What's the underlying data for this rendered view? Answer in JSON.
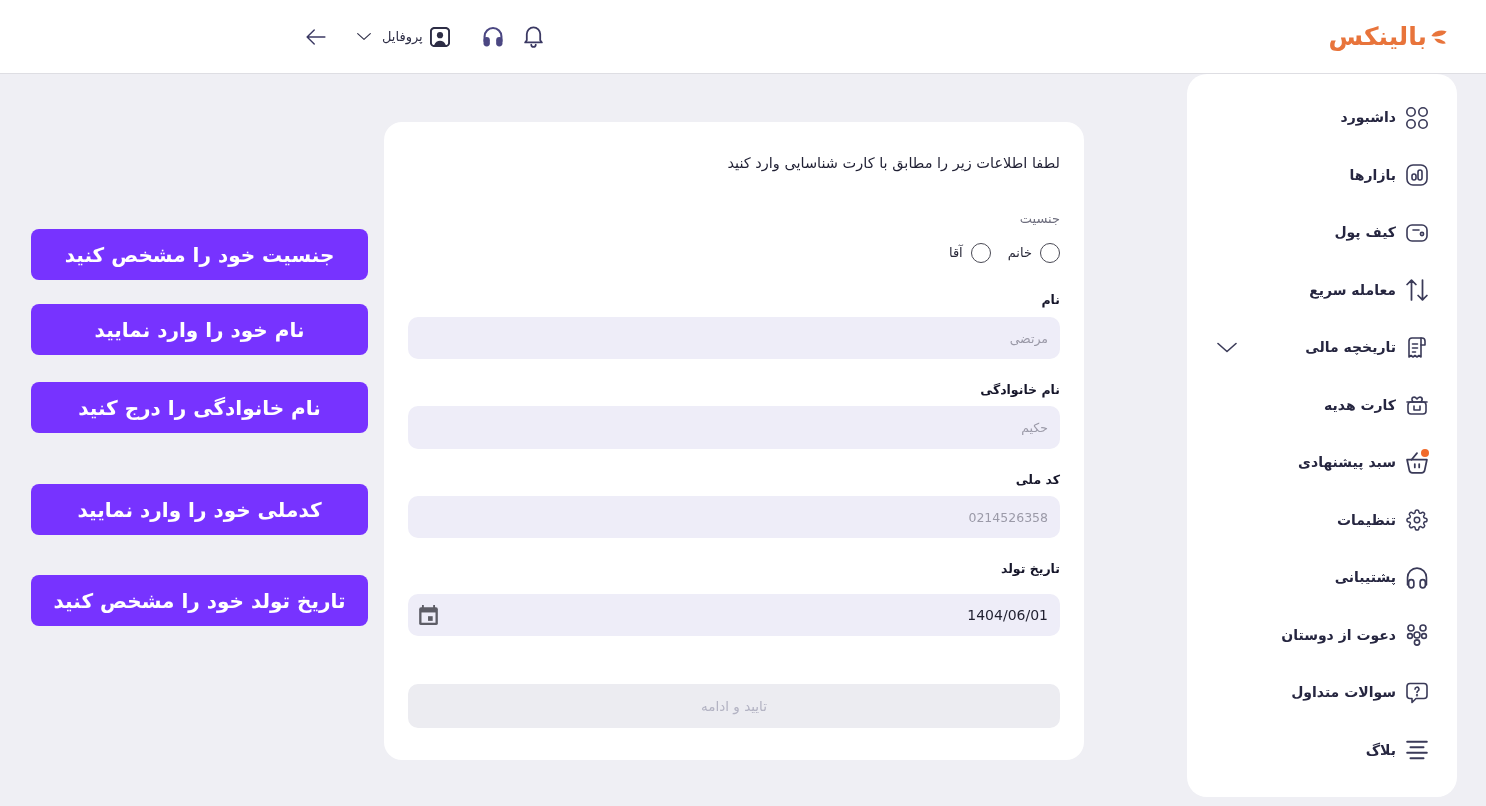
{
  "header": {
    "logo": "بالینکس",
    "profile": {
      "label": "پروفایل",
      "expanded": false
    }
  },
  "sidebar": {
    "items": [
      {
        "label": "داشبورد",
        "kind": "link",
        "notify": false
      },
      {
        "label": "بازارها",
        "kind": "link",
        "notify": false
      },
      {
        "label": "کیف پول",
        "kind": "link",
        "notify": false
      },
      {
        "label": "معامله سریع",
        "kind": "link",
        "notify": false
      },
      {
        "label": "تاریخچه مالی",
        "kind": "group",
        "expanded": false,
        "notify": false
      },
      {
        "label": "کارت هدیه",
        "kind": "link",
        "notify": false
      },
      {
        "label": "سبد پیشنهادی",
        "kind": "link",
        "notify": true
      },
      {
        "label": "تنظیمات",
        "kind": "link",
        "notify": false
      },
      {
        "label": "پشتیبانی",
        "kind": "link",
        "notify": false
      },
      {
        "label": "دعوت از دوستان",
        "kind": "link",
        "notify": false
      },
      {
        "label": "سوالات متداول",
        "kind": "link",
        "notify": false
      },
      {
        "label": "بلاگ",
        "kind": "link",
        "notify": false
      }
    ]
  },
  "form": {
    "instruction": "لطفا اطلاعات زیر را مطابق با کارت شناسایی وارد کنید",
    "gender": {
      "label": "جنسیت",
      "options": [
        {
          "label": "خانم",
          "selected": false
        },
        {
          "label": "آقا",
          "selected": false
        }
      ]
    },
    "fields": [
      {
        "kind": "text",
        "label": "نام",
        "placeholder": "مرتضی"
      },
      {
        "kind": "text",
        "label": "نام خانوادگی",
        "placeholder": "حکیم"
      },
      {
        "kind": "text",
        "label": "کد ملی",
        "placeholder": "0214526358"
      },
      {
        "kind": "date",
        "label": "تاریخ تولد",
        "value": "1404/06/01"
      }
    ],
    "submit": {
      "label": "تایید و ادامه",
      "disabled": true
    }
  },
  "annotations": [
    "جنسیت خود را مشخص کنید",
    "نام خود را وارد نمایید",
    "نام خانوادگی را درج کنید",
    "کدملی خود را وارد نمایید",
    "تاریخ تولد خود را مشخص کنید"
  ]
}
